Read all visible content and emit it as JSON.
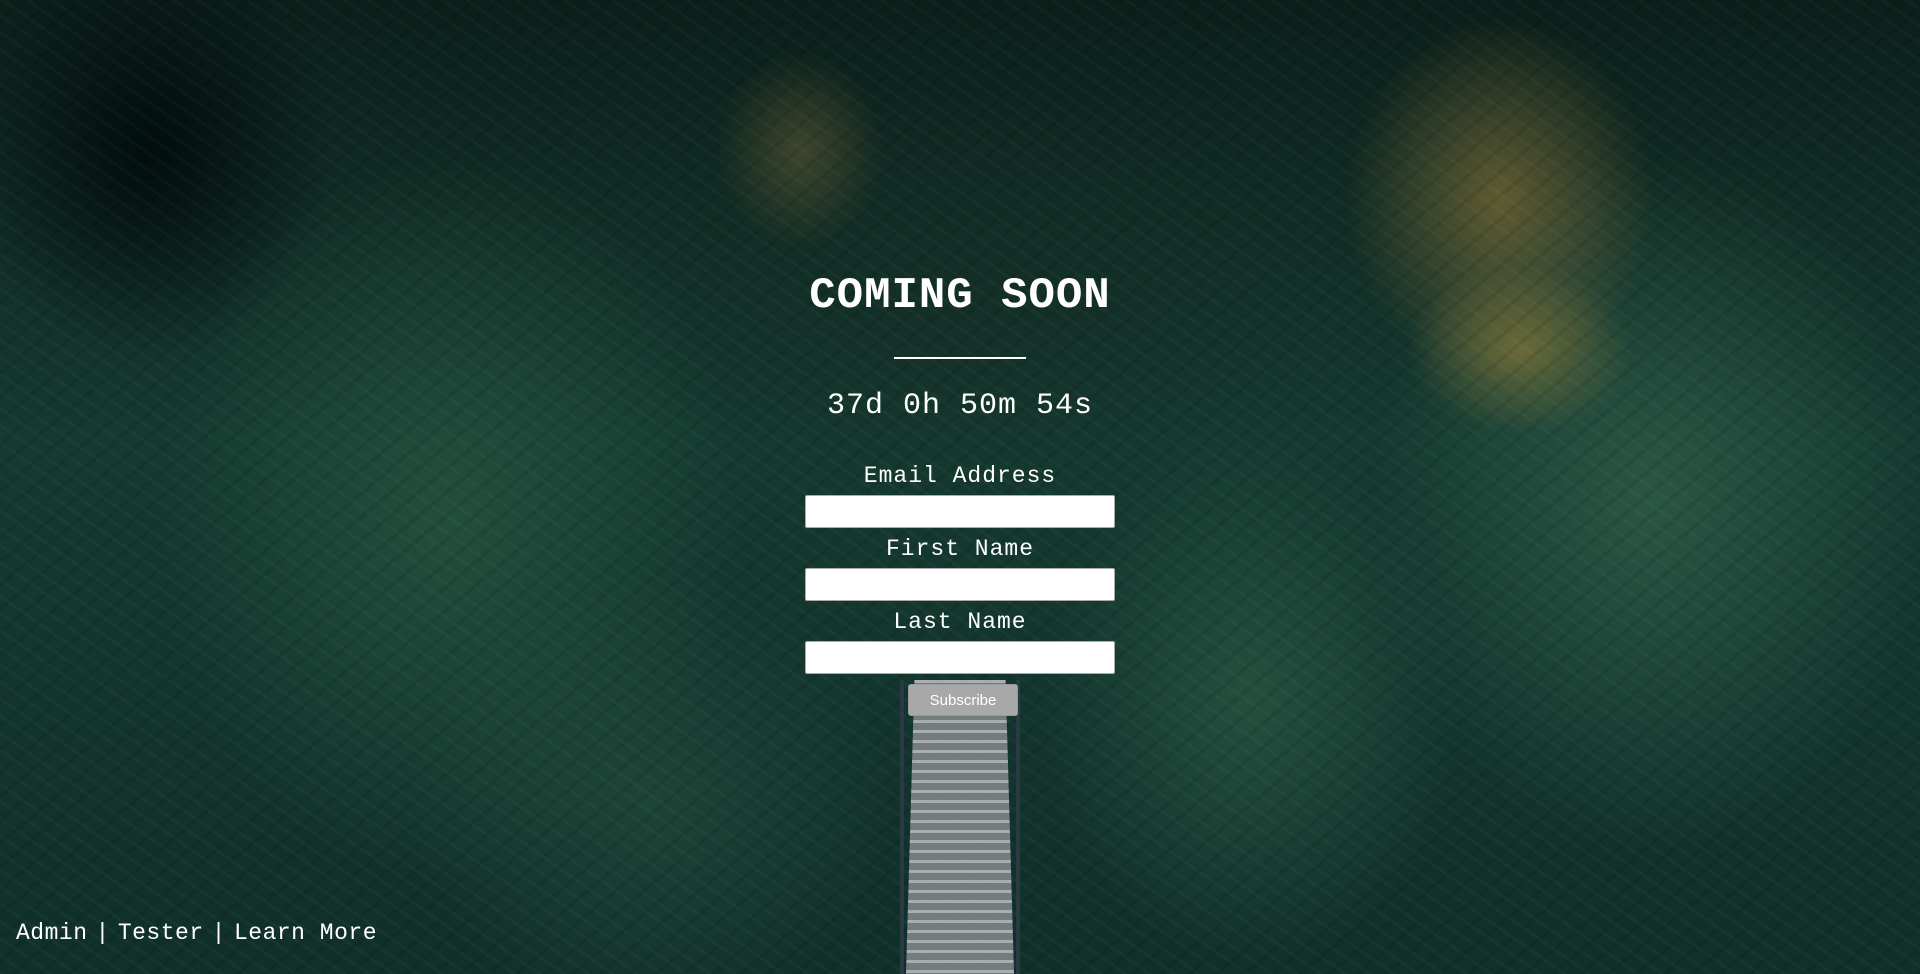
{
  "page": {
    "title": "COMING SOON",
    "countdown": "37d 0h 50m 54s"
  },
  "form": {
    "email_label": "Email Address",
    "email_value": "",
    "first_name_label": "First Name",
    "first_name_value": "",
    "last_name_label": "Last Name",
    "last_name_value": "",
    "submit_label": "Subscribe"
  },
  "footer": {
    "links": [
      "Admin",
      "Tester",
      "Learn More"
    ],
    "separator": "|"
  },
  "colors": {
    "text": "#ffffff",
    "button_bg": "#a8a8a8",
    "background": "#153a30"
  }
}
